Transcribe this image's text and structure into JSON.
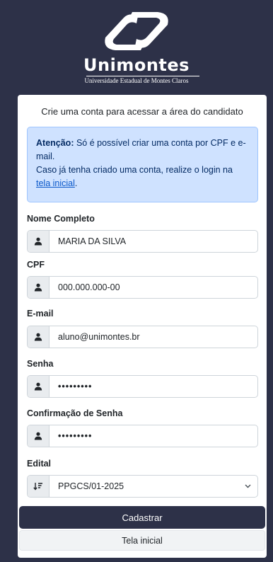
{
  "brand": {
    "name": "Unimontes",
    "subtitle": "Universidade Estadual de Montes Claros"
  },
  "intro": "Crie uma conta para acessar a área do candidato",
  "alert": {
    "strong": "Atenção:",
    "line1": " Só é possível criar uma conta por CPF e e-mail.",
    "line2": "Caso já tenha criado uma conta, realize o login na ",
    "link": "tela inicial",
    "end": "."
  },
  "form": {
    "nome": {
      "label": "Nome Completo",
      "value": "MARIA DA SILVA",
      "icon": "user-icon"
    },
    "cpf": {
      "label": "CPF",
      "value": "000.000.000-00",
      "icon": "user-icon"
    },
    "email": {
      "label": "E-mail",
      "value": "aluno@unimontes.br",
      "icon": "user-icon"
    },
    "senha": {
      "label": "Senha",
      "value": "•••••••••",
      "icon": "user-icon"
    },
    "confirmacao": {
      "label": "Confirmação de Senha",
      "value": "•••••••••",
      "icon": "user-icon"
    },
    "edital": {
      "label": "Edital",
      "value": "PPGCS/01-2025",
      "icon": "sort-icon"
    }
  },
  "buttons": {
    "cadastrar": "Cadastrar",
    "tela_inicial": "Tela inicial"
  },
  "colors": {
    "background": "#2d3148",
    "primary_button": "#2d3148",
    "alert_bg": "#cfe2ff",
    "link": "#0a58ca"
  }
}
